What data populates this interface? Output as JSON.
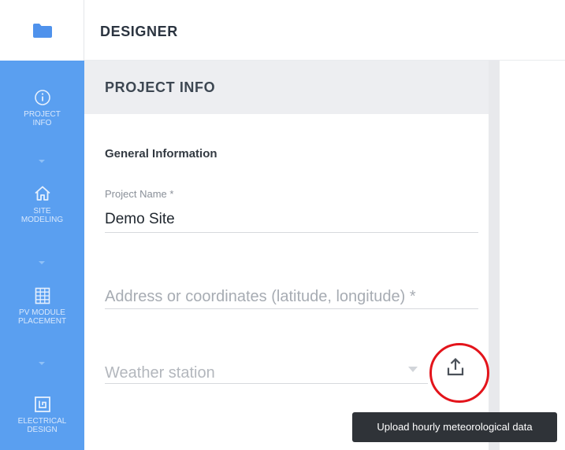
{
  "header": {
    "title": "DESIGNER"
  },
  "sidebar": {
    "items": [
      {
        "label": "PROJECT\nINFO",
        "icon": "info-icon"
      },
      {
        "label": "SITE\nMODELING",
        "icon": "home-icon"
      },
      {
        "label": "PV MODULE\nPLACEMENT",
        "icon": "grid-icon"
      },
      {
        "label": "ELECTRICAL\nDESIGN",
        "icon": "chip-icon"
      }
    ]
  },
  "panel": {
    "title": "PROJECT INFO",
    "section_title": "General Information",
    "project_name": {
      "label": "Project Name *",
      "value": "Demo Site"
    },
    "address": {
      "placeholder": "Address or coordinates (latitude, longitude) *"
    },
    "weather": {
      "placeholder": "Weather station"
    }
  },
  "upload": {
    "icon": "upload-icon",
    "tooltip": "Upload hourly meteorological data"
  },
  "colors": {
    "sidebar": "#5a9ff0",
    "highlight": "#e3141b",
    "tooltip_bg": "#2f3338"
  }
}
